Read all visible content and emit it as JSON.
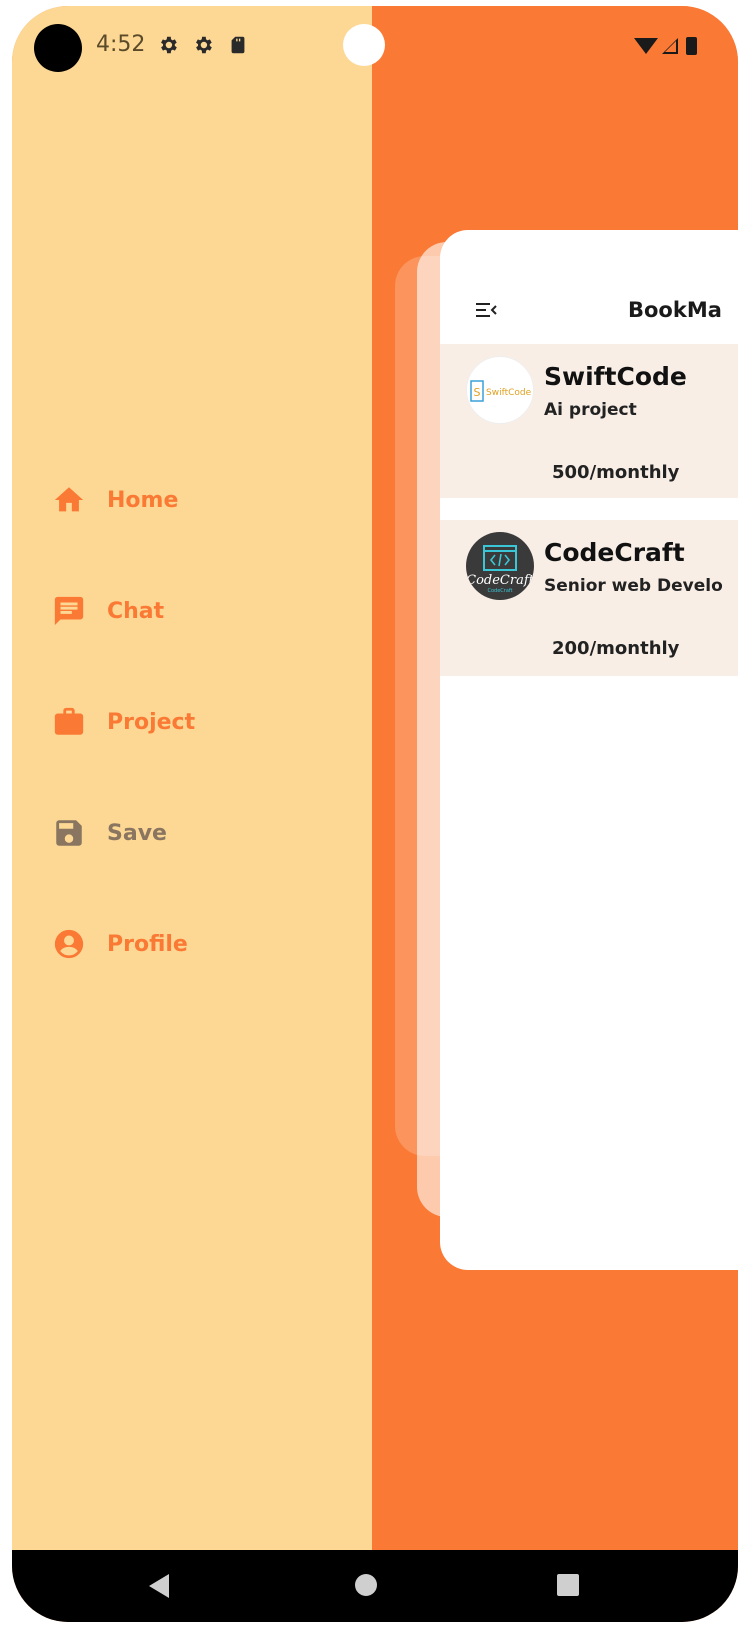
{
  "status_bar": {
    "time": "4:52",
    "icons": [
      "settings-icon",
      "settings-icon",
      "sd-card-icon",
      "wifi-icon",
      "signal-icon",
      "battery-icon"
    ]
  },
  "drawer": {
    "items": [
      {
        "label": "Home",
        "icon": "home-icon"
      },
      {
        "label": "Chat",
        "icon": "chat-icon"
      },
      {
        "label": "Project",
        "icon": "briefcase-icon"
      },
      {
        "label": "Save",
        "icon": "save-icon"
      },
      {
        "label": "Profile",
        "icon": "account-circle-icon"
      }
    ]
  },
  "screen": {
    "title": "BookMa",
    "jobs": [
      {
        "title": "SwiftCode",
        "subtitle": "Ai project",
        "price": "500/monthly",
        "logo_text": "SwiftCode",
        "logo_letter": "S"
      },
      {
        "title": "CodeCraft",
        "subtitle": "Senior web Develo",
        "price": "200/monthly",
        "logo_text": "CodeCraft",
        "logo_caption": "CodeCraft"
      }
    ]
  },
  "colors": {
    "accent": "#FA7A35",
    "drawer_bg": "#FDD894",
    "card_bg": "#F8EEE6",
    "muted": "#8a7560"
  },
  "navigation": [
    "back-icon",
    "home-circle-icon",
    "recents-icon"
  ]
}
